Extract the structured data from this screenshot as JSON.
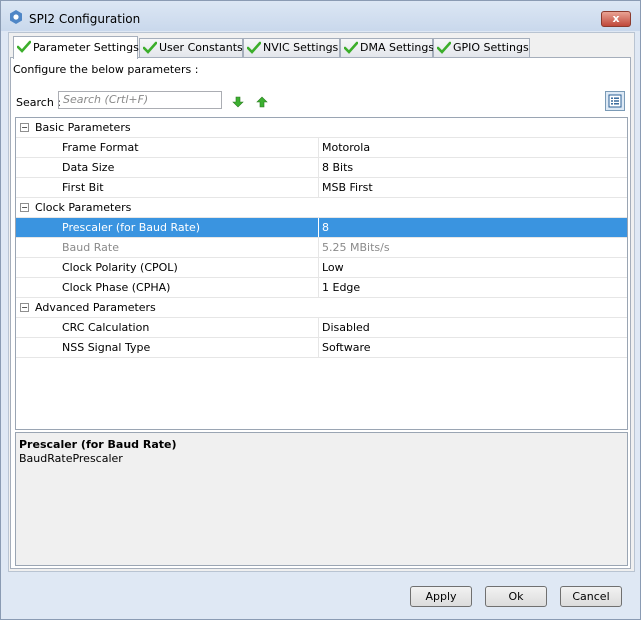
{
  "window": {
    "title": "SPI2 Configuration",
    "close_glyph": "x"
  },
  "tabs": [
    {
      "label": "Parameter Settings",
      "active": true,
      "icon": "check-icon"
    },
    {
      "label": "User Constants",
      "active": false,
      "icon": "check-icon"
    },
    {
      "label": "NVIC Settings",
      "active": false,
      "icon": "check-icon"
    },
    {
      "label": "DMA Settings",
      "active": false,
      "icon": "check-icon"
    },
    {
      "label": "GPIO Settings",
      "active": false,
      "icon": "check-icon"
    }
  ],
  "configure_text": "Configure the below parameters :",
  "search": {
    "label": "Search :",
    "placeholder": "Search (Crtl+F)"
  },
  "groups": [
    {
      "label": "Basic Parameters",
      "toggle": "−",
      "params": [
        {
          "name": "Frame Format",
          "value": "Motorola"
        },
        {
          "name": "Data Size",
          "value": "8 Bits"
        },
        {
          "name": "First Bit",
          "value": "MSB First"
        }
      ]
    },
    {
      "label": "Clock Parameters",
      "toggle": "−",
      "params": [
        {
          "name": "Prescaler (for Baud Rate)",
          "value": "8"
        },
        {
          "name": "Baud Rate",
          "value": "5.25 MBits/s"
        },
        {
          "name": "Clock Polarity (CPOL)",
          "value": "Low"
        },
        {
          "name": "Clock Phase (CPHA)",
          "value": "1 Edge"
        }
      ]
    },
    {
      "label": "Advanced Parameters",
      "toggle": "−",
      "params": [
        {
          "name": "CRC Calculation",
          "value": "Disabled"
        },
        {
          "name": "NSS Signal Type",
          "value": "Software"
        }
      ]
    }
  ],
  "description": {
    "title": "Prescaler (for Baud Rate)",
    "body": "BaudRatePrescaler"
  },
  "buttons": {
    "apply": "Apply",
    "ok": "Ok",
    "cancel": "Cancel"
  },
  "colors": {
    "selection": "#3a94e0",
    "check_green": "#3cae2b",
    "arrow_green": "#3cb030"
  }
}
